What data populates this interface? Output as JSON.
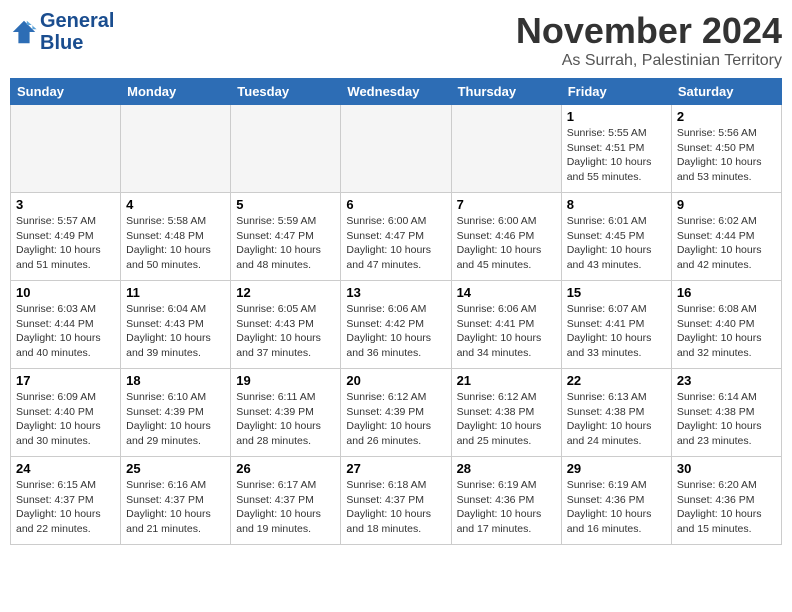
{
  "header": {
    "logo_line1": "General",
    "logo_line2": "Blue",
    "month_title": "November 2024",
    "location": "As Surrah, Palestinian Territory"
  },
  "weekdays": [
    "Sunday",
    "Monday",
    "Tuesday",
    "Wednesday",
    "Thursday",
    "Friday",
    "Saturday"
  ],
  "weeks": [
    [
      {
        "day": "",
        "info": "",
        "empty": true
      },
      {
        "day": "",
        "info": "",
        "empty": true
      },
      {
        "day": "",
        "info": "",
        "empty": true
      },
      {
        "day": "",
        "info": "",
        "empty": true
      },
      {
        "day": "",
        "info": "",
        "empty": true
      },
      {
        "day": "1",
        "info": "Sunrise: 5:55 AM\nSunset: 4:51 PM\nDaylight: 10 hours\nand 55 minutes."
      },
      {
        "day": "2",
        "info": "Sunrise: 5:56 AM\nSunset: 4:50 PM\nDaylight: 10 hours\nand 53 minutes."
      }
    ],
    [
      {
        "day": "3",
        "info": "Sunrise: 5:57 AM\nSunset: 4:49 PM\nDaylight: 10 hours\nand 51 minutes."
      },
      {
        "day": "4",
        "info": "Sunrise: 5:58 AM\nSunset: 4:48 PM\nDaylight: 10 hours\nand 50 minutes."
      },
      {
        "day": "5",
        "info": "Sunrise: 5:59 AM\nSunset: 4:47 PM\nDaylight: 10 hours\nand 48 minutes."
      },
      {
        "day": "6",
        "info": "Sunrise: 6:00 AM\nSunset: 4:47 PM\nDaylight: 10 hours\nand 47 minutes."
      },
      {
        "day": "7",
        "info": "Sunrise: 6:00 AM\nSunset: 4:46 PM\nDaylight: 10 hours\nand 45 minutes."
      },
      {
        "day": "8",
        "info": "Sunrise: 6:01 AM\nSunset: 4:45 PM\nDaylight: 10 hours\nand 43 minutes."
      },
      {
        "day": "9",
        "info": "Sunrise: 6:02 AM\nSunset: 4:44 PM\nDaylight: 10 hours\nand 42 minutes."
      }
    ],
    [
      {
        "day": "10",
        "info": "Sunrise: 6:03 AM\nSunset: 4:44 PM\nDaylight: 10 hours\nand 40 minutes."
      },
      {
        "day": "11",
        "info": "Sunrise: 6:04 AM\nSunset: 4:43 PM\nDaylight: 10 hours\nand 39 minutes."
      },
      {
        "day": "12",
        "info": "Sunrise: 6:05 AM\nSunset: 4:43 PM\nDaylight: 10 hours\nand 37 minutes."
      },
      {
        "day": "13",
        "info": "Sunrise: 6:06 AM\nSunset: 4:42 PM\nDaylight: 10 hours\nand 36 minutes."
      },
      {
        "day": "14",
        "info": "Sunrise: 6:06 AM\nSunset: 4:41 PM\nDaylight: 10 hours\nand 34 minutes."
      },
      {
        "day": "15",
        "info": "Sunrise: 6:07 AM\nSunset: 4:41 PM\nDaylight: 10 hours\nand 33 minutes."
      },
      {
        "day": "16",
        "info": "Sunrise: 6:08 AM\nSunset: 4:40 PM\nDaylight: 10 hours\nand 32 minutes."
      }
    ],
    [
      {
        "day": "17",
        "info": "Sunrise: 6:09 AM\nSunset: 4:40 PM\nDaylight: 10 hours\nand 30 minutes."
      },
      {
        "day": "18",
        "info": "Sunrise: 6:10 AM\nSunset: 4:39 PM\nDaylight: 10 hours\nand 29 minutes."
      },
      {
        "day": "19",
        "info": "Sunrise: 6:11 AM\nSunset: 4:39 PM\nDaylight: 10 hours\nand 28 minutes."
      },
      {
        "day": "20",
        "info": "Sunrise: 6:12 AM\nSunset: 4:39 PM\nDaylight: 10 hours\nand 26 minutes."
      },
      {
        "day": "21",
        "info": "Sunrise: 6:12 AM\nSunset: 4:38 PM\nDaylight: 10 hours\nand 25 minutes."
      },
      {
        "day": "22",
        "info": "Sunrise: 6:13 AM\nSunset: 4:38 PM\nDaylight: 10 hours\nand 24 minutes."
      },
      {
        "day": "23",
        "info": "Sunrise: 6:14 AM\nSunset: 4:38 PM\nDaylight: 10 hours\nand 23 minutes."
      }
    ],
    [
      {
        "day": "24",
        "info": "Sunrise: 6:15 AM\nSunset: 4:37 PM\nDaylight: 10 hours\nand 22 minutes."
      },
      {
        "day": "25",
        "info": "Sunrise: 6:16 AM\nSunset: 4:37 PM\nDaylight: 10 hours\nand 21 minutes."
      },
      {
        "day": "26",
        "info": "Sunrise: 6:17 AM\nSunset: 4:37 PM\nDaylight: 10 hours\nand 19 minutes."
      },
      {
        "day": "27",
        "info": "Sunrise: 6:18 AM\nSunset: 4:37 PM\nDaylight: 10 hours\nand 18 minutes."
      },
      {
        "day": "28",
        "info": "Sunrise: 6:19 AM\nSunset: 4:36 PM\nDaylight: 10 hours\nand 17 minutes."
      },
      {
        "day": "29",
        "info": "Sunrise: 6:19 AM\nSunset: 4:36 PM\nDaylight: 10 hours\nand 16 minutes."
      },
      {
        "day": "30",
        "info": "Sunrise: 6:20 AM\nSunset: 4:36 PM\nDaylight: 10 hours\nand 15 minutes."
      }
    ]
  ]
}
